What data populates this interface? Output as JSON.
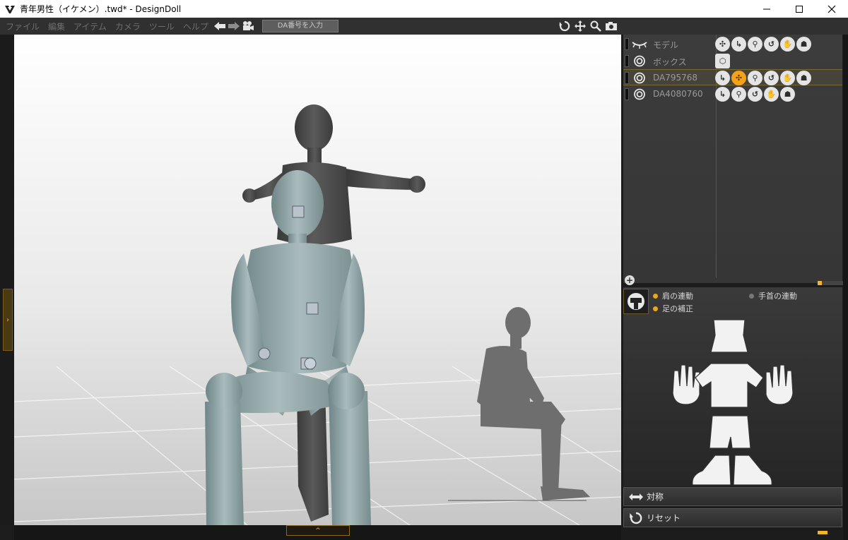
{
  "window": {
    "title": "青年男性（イケメン）.twd* - DesignDoll",
    "minimize_icon": "minimize-icon",
    "maximize_icon": "maximize-icon",
    "close_icon": "close-icon"
  },
  "menu": {
    "items": [
      "ファイル",
      "編集",
      "アイテム",
      "カメラ",
      "ツール",
      "ヘルプ"
    ],
    "da_input_placeholder": "DA番号を入力"
  },
  "toolbar_icons": [
    "rotate-icon",
    "move-icon",
    "zoom-icon",
    "camera-icon"
  ],
  "scene_list": {
    "rows": [
      {
        "label": "モデル",
        "icons": [
          "model-rotate",
          "ik",
          "zoom",
          "rotate",
          "hand",
          "foot"
        ],
        "selected": false
      },
      {
        "label": "ボックス",
        "icons": [
          "box"
        ],
        "selected": false
      },
      {
        "label": "DA795768",
        "icons": [
          "ik",
          "model-rotate",
          "zoom",
          "rotate",
          "hand",
          "foot"
        ],
        "selected": true
      },
      {
        "label": "DA4080760",
        "icons": [
          "ik",
          "zoom",
          "rotate",
          "hand",
          "foot"
        ],
        "selected": false
      }
    ]
  },
  "body_panel": {
    "options": {
      "shoulder_link": "肩の連動",
      "wrist_link": "手首の連動",
      "foot_correction": "足の補正"
    }
  },
  "buttons": {
    "symmetry": "対称",
    "reset": "リセット"
  },
  "colors": {
    "accent": "#f0b430",
    "active_icon": "#f3a21a",
    "doll_primary": "#8fa3a5",
    "doll_secondary": "#4e4e4e"
  }
}
